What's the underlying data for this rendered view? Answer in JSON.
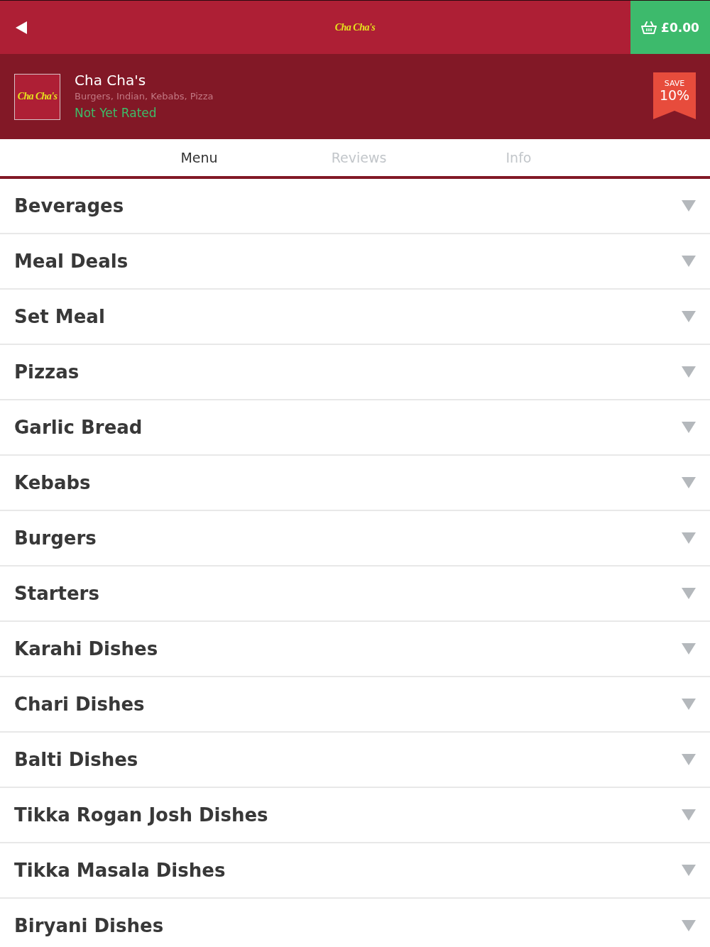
{
  "top_bar": {
    "logo_text": "Cha Cha's",
    "cart_total": "£0.00"
  },
  "restaurant": {
    "logo_text": "Cha Cha's",
    "name": "Cha Cha's",
    "cuisines": "Burgers, Indian, Kebabs, Pizza",
    "rating": "Not Yet Rated",
    "badge": {
      "label": "SAVE",
      "value": "10%"
    }
  },
  "tabs": [
    {
      "label": "Menu",
      "selected": true
    },
    {
      "label": "Reviews",
      "selected": false
    },
    {
      "label": "Info",
      "selected": false
    }
  ],
  "categories": [
    {
      "name": "Beverages",
      "expanded": false
    },
    {
      "name": "Meal Deals",
      "expanded": false
    },
    {
      "name": "Set Meal",
      "expanded": false
    },
    {
      "name": "Pizzas",
      "expanded": false
    },
    {
      "name": "Garlic Bread",
      "expanded": false
    },
    {
      "name": "Kebabs",
      "expanded": false
    },
    {
      "name": "Burgers",
      "expanded": false
    },
    {
      "name": "Starters",
      "expanded": false
    },
    {
      "name": "Karahi Dishes",
      "expanded": false
    },
    {
      "name": "Chari Dishes",
      "expanded": false
    },
    {
      "name": "Balti Dishes",
      "expanded": false
    },
    {
      "name": "Tikka Rogan Josh Dishes",
      "expanded": false
    },
    {
      "name": "Tikka Masala Dishes",
      "expanded": false
    },
    {
      "name": "Biryani Dishes",
      "expanded": false
    }
  ]
}
